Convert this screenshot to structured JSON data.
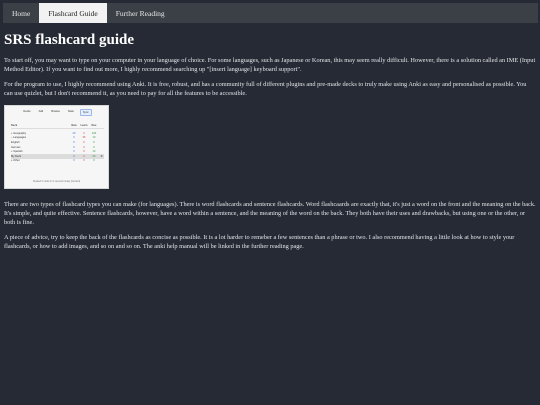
{
  "nav": {
    "tabs": [
      {
        "label": "Home",
        "active": false
      },
      {
        "label": "Flashcard Guide",
        "active": true
      },
      {
        "label": "Further Reading",
        "active": false
      }
    ]
  },
  "main": {
    "title": "SRS flashcard guide",
    "paragraphs": [
      "To start off, you may want to type on your computer in your language of choice. For some languages, such as Japanese or Korean, this may seem really difficult. However, there is a solution called an IME (Input Method Editor). If you want to find out more, I highly recommend searching up \"[insert language] keyboard support\".",
      "For the program to use, I highly recommend using Anki. It is free, robust, and has a community full of different plugins and pre-made decks to truly make using Anki as easy and personalised as possible. You can use quizlet, but I don't recommend it, as you need to pay for all the features to be accessible.",
      "There are two types of flashcard types you can make (for languages). There is word flashcards and sentence flashcards. Word flashcaards are exactly that, it's just a word on the front and the meaning on the back. It's simple, and quite effective. Sentence flashcards, however, have a word within a sentence, and the meaning of the word on the back. They both have their uses and drawbacks, but using one or the other, or both is fine.",
      "A piece of advice, try to keep the back of the flashcards as concise as possible. It is a lot harder to remeber a few sentences than a phrase or two. I also recommend having a little look at how to style your flashcards, or how to add images, and so on and so on. The anki help manual will be linked in the further reading page."
    ]
  },
  "anki_screenshot": {
    "toolbar": [
      "Decks",
      "Add",
      "Browse",
      "Stats",
      "Sync"
    ],
    "selected_toolbar": "Sync",
    "columns": [
      "Deck",
      "New",
      "Learn",
      "Due"
    ],
    "rows": [
      {
        "name": "+ Geography",
        "new": "20",
        "learn": "0",
        "due": "100",
        "highlight": false
      },
      {
        "name": "– Languages",
        "new": "0",
        "learn": "35",
        "due": "13",
        "highlight": false
      },
      {
        "name": "    English",
        "new": "0",
        "learn": "0",
        "due": "0",
        "highlight": false
      },
      {
        "name": "    German",
        "new": "0",
        "learn": "0",
        "due": "0",
        "highlight": false
      },
      {
        "name": "  + Spanish",
        "new": "0",
        "learn": "0",
        "due": "13",
        "highlight": false
      },
      {
        "name": "My Deck",
        "new": "0",
        "learn": "2",
        "due": "20",
        "highlight": true
      },
      {
        "name": "+ Other",
        "new": "0",
        "learn": "0",
        "due": "0",
        "highlight": false
      }
    ],
    "footer": "Studied 0 cards in 0 seconds today (0s/card)",
    "colors": {
      "new": "#3a6fd8",
      "learn": "#d04040",
      "due": "#2f8f3a"
    }
  }
}
